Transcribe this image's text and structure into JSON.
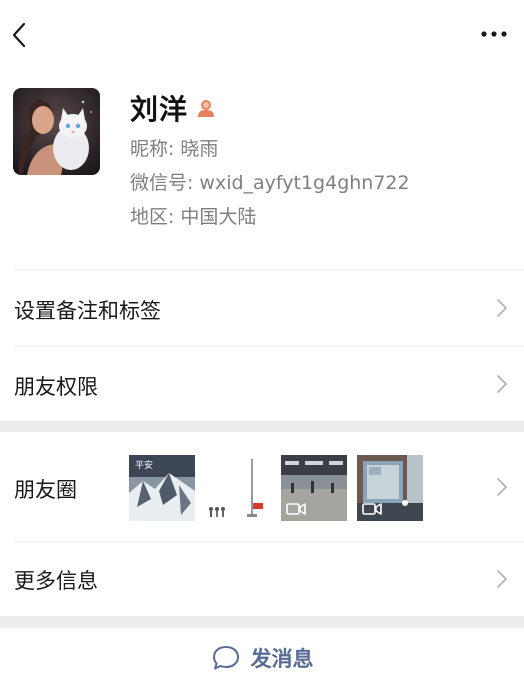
{
  "header": {
    "back_icon": "chevron-left-icon",
    "more_icon": "more-dots-icon"
  },
  "profile": {
    "name": "刘洋",
    "gender_icon": "person-icon",
    "gender_color": "#e8805b",
    "nickname_label": "昵称:",
    "nickname": "晓雨",
    "wechat_id_label": "微信号:",
    "wechat_id": "wxid_ayfyt1g4ghn722",
    "region_label": "地区:",
    "region": "中国大陆"
  },
  "rows": {
    "remark_label": "设置备注和标签",
    "permissions_label": "朋友权限",
    "moments_label": "朋友圈",
    "more_info_label": "更多信息"
  },
  "moments": {
    "thumb1_text": "平安"
  },
  "actions": {
    "send_message_label": "发消息",
    "send_message_icon": "chat-bubble-icon"
  },
  "colors": {
    "link_blue": "#576b95",
    "gap_gray": "#ededed",
    "secondary_text": "#7f7f7f"
  }
}
